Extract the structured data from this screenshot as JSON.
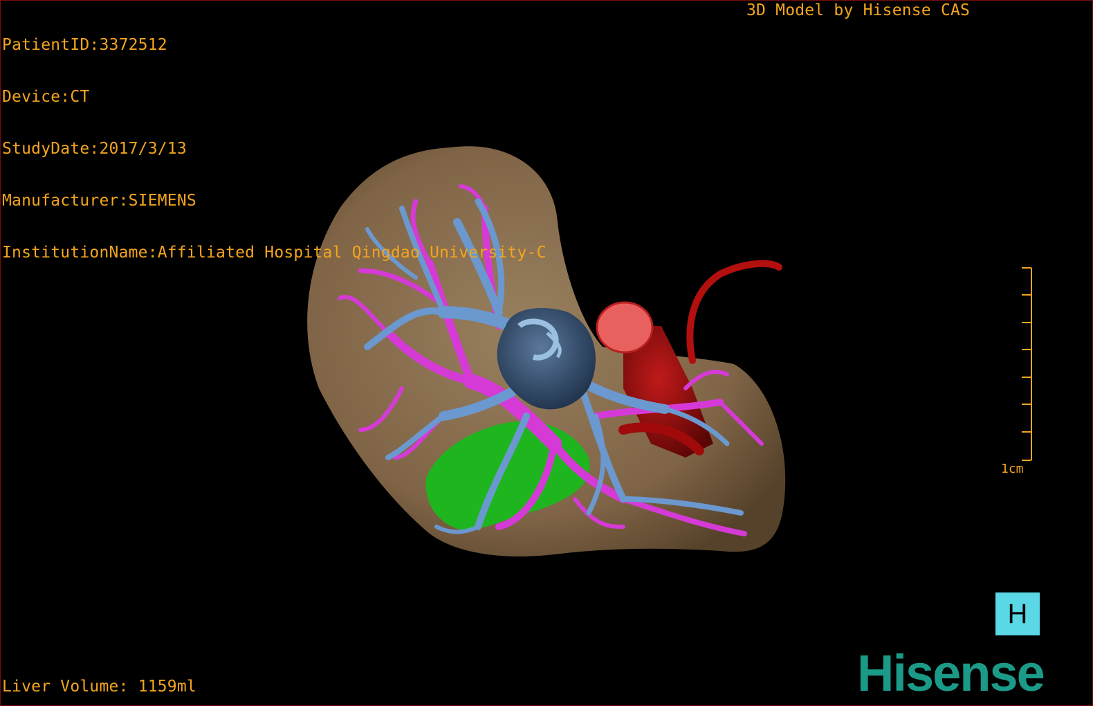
{
  "header": {
    "patient_id": "PatientID:3372512",
    "device": "Device:CT",
    "study_date": "StudyDate:2017/3/13",
    "manufacturer": "Manufacturer:SIEMENS",
    "institution": "InstitutionName:Affiliated Hospital Qingdao University-C"
  },
  "credit": "3D Model by Hisense CAS",
  "footer": {
    "liver_volume": "Liver Volume: 1159ml"
  },
  "scale": {
    "label": "1cm",
    "ticks": 8
  },
  "orientation_button": {
    "label": "H"
  },
  "logo": {
    "text": "Hisense"
  },
  "colors": {
    "overlay_text": "#f3a51e",
    "liver": "#8c7352",
    "portal_vein": "#d63ad6",
    "hepatic_vein": "#6b98cf",
    "ivc": "#3d5878",
    "aorta": "#9a0f0f",
    "lesion": "#1fb51f",
    "logo": "#1b9a88",
    "orientation_button": "#5ad8e6"
  },
  "model": {
    "structures": [
      "liver",
      "portal-vein",
      "hepatic-vein",
      "inferior-vena-cava",
      "aorta",
      "lesion"
    ]
  }
}
